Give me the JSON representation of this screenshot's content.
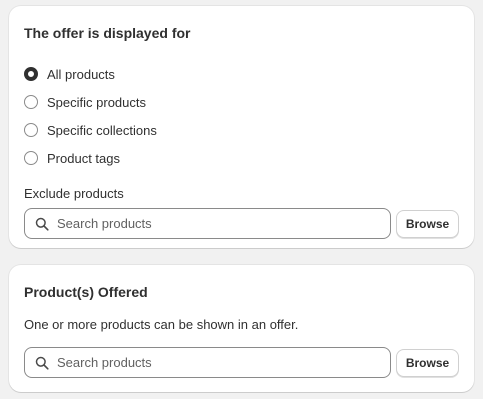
{
  "display_card": {
    "title": "The offer is displayed for",
    "options": [
      {
        "label": "All products",
        "checked": true
      },
      {
        "label": "Specific products",
        "checked": false
      },
      {
        "label": "Specific collections",
        "checked": false
      },
      {
        "label": "Product tags",
        "checked": false
      }
    ],
    "exclude_label": "Exclude products",
    "search": {
      "placeholder": "Search products",
      "value": ""
    },
    "browse_label": "Browse"
  },
  "offered_card": {
    "title": "Product(s) Offered",
    "help_text": "One or more products can be shown in an offer.",
    "search": {
      "placeholder": "Search products",
      "value": ""
    },
    "browse_label": "Browse"
  },
  "icons": {
    "search": "search-icon"
  },
  "colors": {
    "background": "#f1f1f1",
    "card": "#ffffff",
    "text": "#303030",
    "border": "#8a8a8a"
  }
}
